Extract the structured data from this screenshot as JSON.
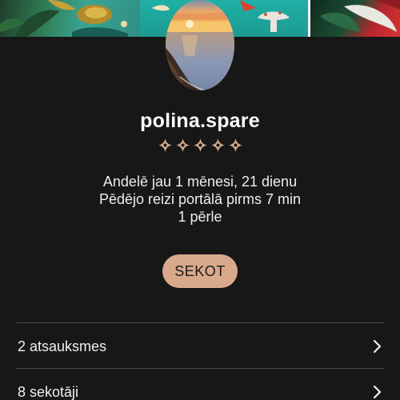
{
  "profile": {
    "username": "polina.spare",
    "rating_stars": 5,
    "member_since": "Andelē jau 1 mēnesi, 21 dienu",
    "last_seen": "Pēdējo reizi portālā pirms 7 min",
    "pearls": "1 pērle"
  },
  "actions": {
    "follow_label": "SEKOT"
  },
  "list": {
    "reviews_label": "2 atsauksmes",
    "followers_label": "8 sekotāji"
  },
  "colors": {
    "background": "#171718",
    "accent": "#d8a98a",
    "divider": "#4a4a4c"
  },
  "icons": {
    "rating": "sparkle-star-icon",
    "row_arrow": "chevron-right-icon"
  }
}
